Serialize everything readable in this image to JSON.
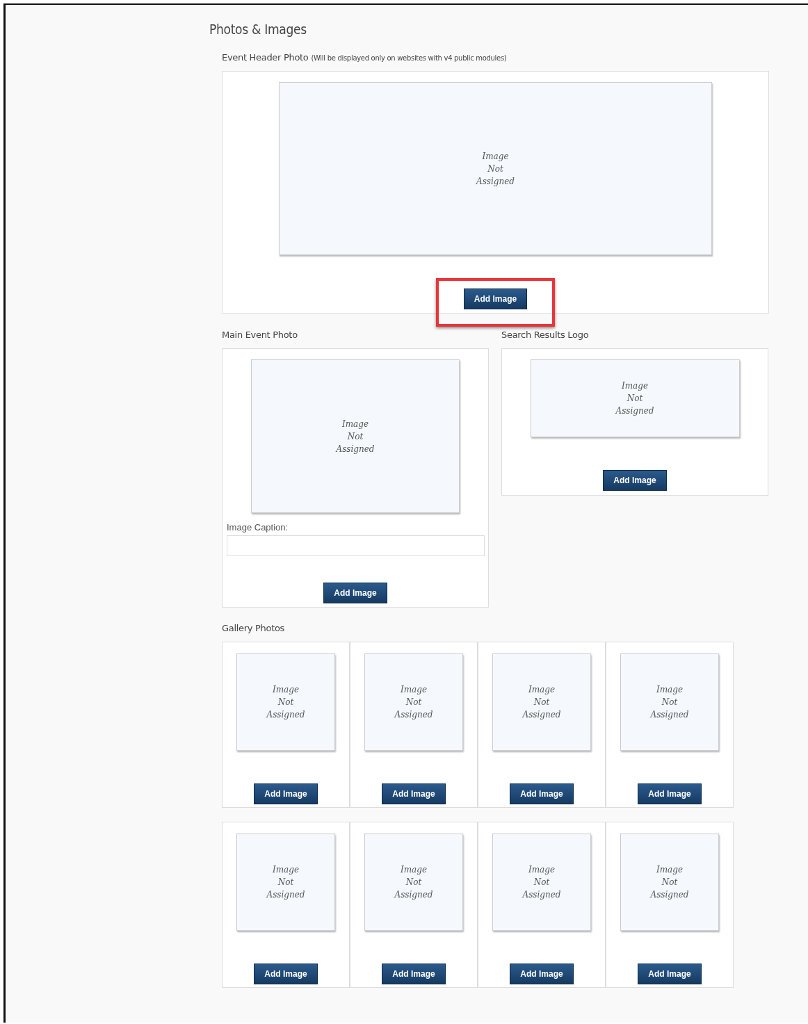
{
  "title": "Photos & Images",
  "header_photo": {
    "label": "Event Header Photo",
    "note": "(Will be displayed only on websites with v4 public modules)",
    "placeholder_text": "Image\nNot\nAssigned",
    "button": {
      "label": "Add Image",
      "highlighted": true
    }
  },
  "main_photo": {
    "label": "Main Event Photo",
    "placeholder_text": "Image\nNot\nAssigned",
    "caption_label": "Image Caption:",
    "button": {
      "label": "Add Image",
      "highlighted": false
    }
  },
  "search_logo": {
    "label": "Search Results Logo",
    "placeholder_text": "Image\nNot\nAssigned",
    "button": {
      "label": "Add Image",
      "highlighted": false
    }
  },
  "gallery": {
    "label": "Gallery Photos",
    "rows": [
      [
        {
          "placeholder_text": "Image\nNot\nAssigned",
          "button": "Add Image"
        },
        {
          "placeholder_text": "Image\nNot\nAssigned",
          "button": "Add Image"
        },
        {
          "placeholder_text": "Image\nNot\nAssigned",
          "button": "Add Image"
        },
        {
          "placeholder_text": "Image\nNot\nAssigned",
          "button": "Add Image"
        }
      ],
      [
        {
          "placeholder_text": "Image\nNot\nAssigned",
          "button": "Add Image"
        },
        {
          "placeholder_text": "Image\nNot\nAssigned",
          "button": "Add Image"
        },
        {
          "placeholder_text": "Image\nNot\nAssigned",
          "button": "Add Image"
        },
        {
          "placeholder_text": "Image\nNot\nAssigned",
          "button": "Add Image"
        }
      ]
    ]
  }
}
